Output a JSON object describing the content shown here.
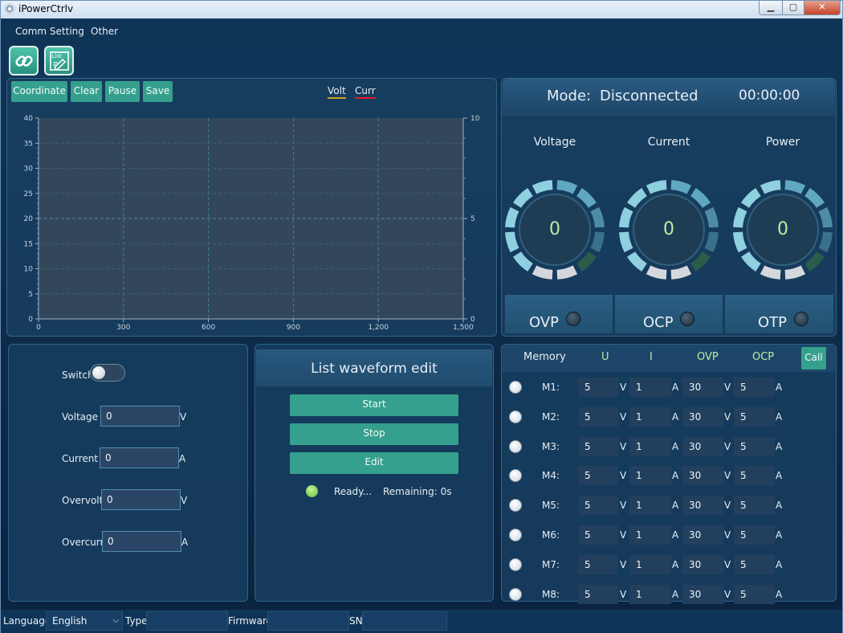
{
  "window": {
    "title": "iPowerCtrlv",
    "min": "▁",
    "max": "▢",
    "close": "✕"
  },
  "menu": {
    "items": [
      "Comm Setting",
      "Other"
    ]
  },
  "toolbar": {
    "connect_icon": "link-icon",
    "list_icon": "list-edit-icon",
    "list_label": "List"
  },
  "chart_panel": {
    "buttons": [
      "Coordinate",
      "Clear",
      "Pause",
      "Save"
    ],
    "legend": [
      {
        "name": "Volt",
        "color": "#c8a028"
      },
      {
        "name": "Curr",
        "color": "#e0202c"
      }
    ]
  },
  "chart_data": {
    "type": "line",
    "xlim": [
      0,
      1500
    ],
    "x_ticks": [
      0,
      300,
      600,
      900,
      1200,
      1500
    ],
    "x_tick_labels": [
      "0",
      "300",
      "600",
      "900",
      "1,200",
      "1,500"
    ],
    "ylim": [
      0,
      40
    ],
    "y_ticks": [
      0,
      5,
      10,
      15,
      20,
      25,
      30,
      35,
      40
    ],
    "y2lim": [
      0,
      10
    ],
    "y2_ticks": [
      0,
      5,
      10
    ],
    "grid": true,
    "legend_position": "top-center",
    "series": [
      {
        "name": "Volt",
        "values": [],
        "color": "#c8a028"
      },
      {
        "name": "Curr",
        "values": [],
        "color": "#e0202c"
      }
    ]
  },
  "status_panel": {
    "mode_label": "Mode:",
    "mode_value": "Disconnected",
    "timer": "00:00:00",
    "gauges": [
      {
        "label": "Voltage",
        "value": "0"
      },
      {
        "label": "Current",
        "value": "0"
      },
      {
        "label": "Power",
        "value": "0"
      }
    ],
    "protections": [
      "OVP",
      "OCP",
      "OTP"
    ]
  },
  "control_panel": {
    "switch_label": "Switch",
    "fields": [
      {
        "label": "Voltage :",
        "value": "0",
        "unit": "V"
      },
      {
        "label": "Current :",
        "value": "0",
        "unit": "A"
      },
      {
        "label": "Overvolt:",
        "value": "0",
        "unit": "V"
      },
      {
        "label": "Overcurr:",
        "value": "0",
        "unit": "A"
      }
    ]
  },
  "list_panel": {
    "title": "List waveform edit",
    "buttons": [
      "Start",
      "Stop",
      "Edit"
    ],
    "status": "Ready...",
    "remaining": "Remaining: 0s"
  },
  "memory_panel": {
    "headers": [
      "Memory",
      "U",
      "I",
      "OVP",
      "OCP"
    ],
    "call_label": "Call",
    "unit_v": "V",
    "unit_a": "A",
    "rows": [
      {
        "name": "M1:",
        "u": "5",
        "i": "1",
        "ovp": "30",
        "ocp": "5"
      },
      {
        "name": "M2:",
        "u": "5",
        "i": "1",
        "ovp": "30",
        "ocp": "5"
      },
      {
        "name": "M3:",
        "u": "5",
        "i": "1",
        "ovp": "30",
        "ocp": "5"
      },
      {
        "name": "M4:",
        "u": "5",
        "i": "1",
        "ovp": "30",
        "ocp": "5"
      },
      {
        "name": "M5:",
        "u": "5",
        "i": "1",
        "ovp": "30",
        "ocp": "5"
      },
      {
        "name": "M6:",
        "u": "5",
        "i": "1",
        "ovp": "30",
        "ocp": "5"
      },
      {
        "name": "M7:",
        "u": "5",
        "i": "1",
        "ovp": "30",
        "ocp": "5"
      },
      {
        "name": "M8:",
        "u": "5",
        "i": "1",
        "ovp": "30",
        "ocp": "5"
      }
    ]
  },
  "statusbar": {
    "language_label": "Language",
    "language_value": "English",
    "type_label": "Type",
    "type_value": "",
    "firmware_label": "Firmware",
    "firmware_value": "",
    "sn_label": "SN",
    "sn_value": ""
  },
  "colors": {
    "accent": "#35a08d",
    "gauge_value": "#b6f0a4",
    "background": "#0d2a47"
  }
}
